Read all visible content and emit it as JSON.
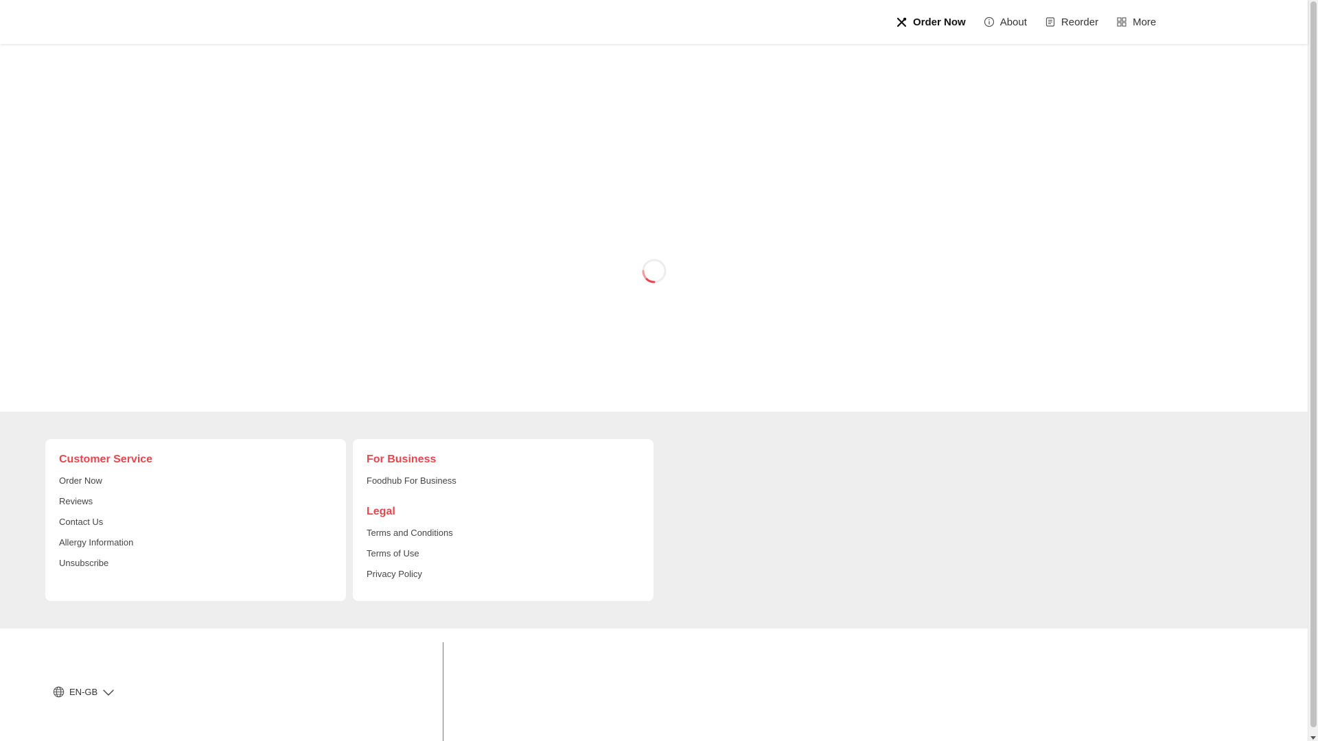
{
  "header": {
    "nav": [
      {
        "label": "Order Now",
        "icon": "utensils-icon",
        "active": true
      },
      {
        "label": "About",
        "icon": "info-icon"
      },
      {
        "label": "Reorder",
        "icon": "receipt-icon"
      },
      {
        "label": "More",
        "icon": "grid-icon"
      }
    ]
  },
  "main": {
    "loading": true
  },
  "footer": {
    "customer_service": {
      "heading": "Customer Service",
      "links": [
        "Order Now",
        "Reviews",
        "Contact Us",
        "Allergy Information",
        "Unsubscribe"
      ]
    },
    "for_business": {
      "heading": "For Business",
      "links": [
        "Foodhub For Business"
      ]
    },
    "legal": {
      "heading": "Legal",
      "links": [
        "Terms and Conditions",
        "Terms of Use",
        "Privacy Policy"
      ]
    }
  },
  "bottom": {
    "language": "EN-GB"
  },
  "colors": {
    "accent": "#e8454f",
    "footer_bg": "#eeeeee"
  }
}
